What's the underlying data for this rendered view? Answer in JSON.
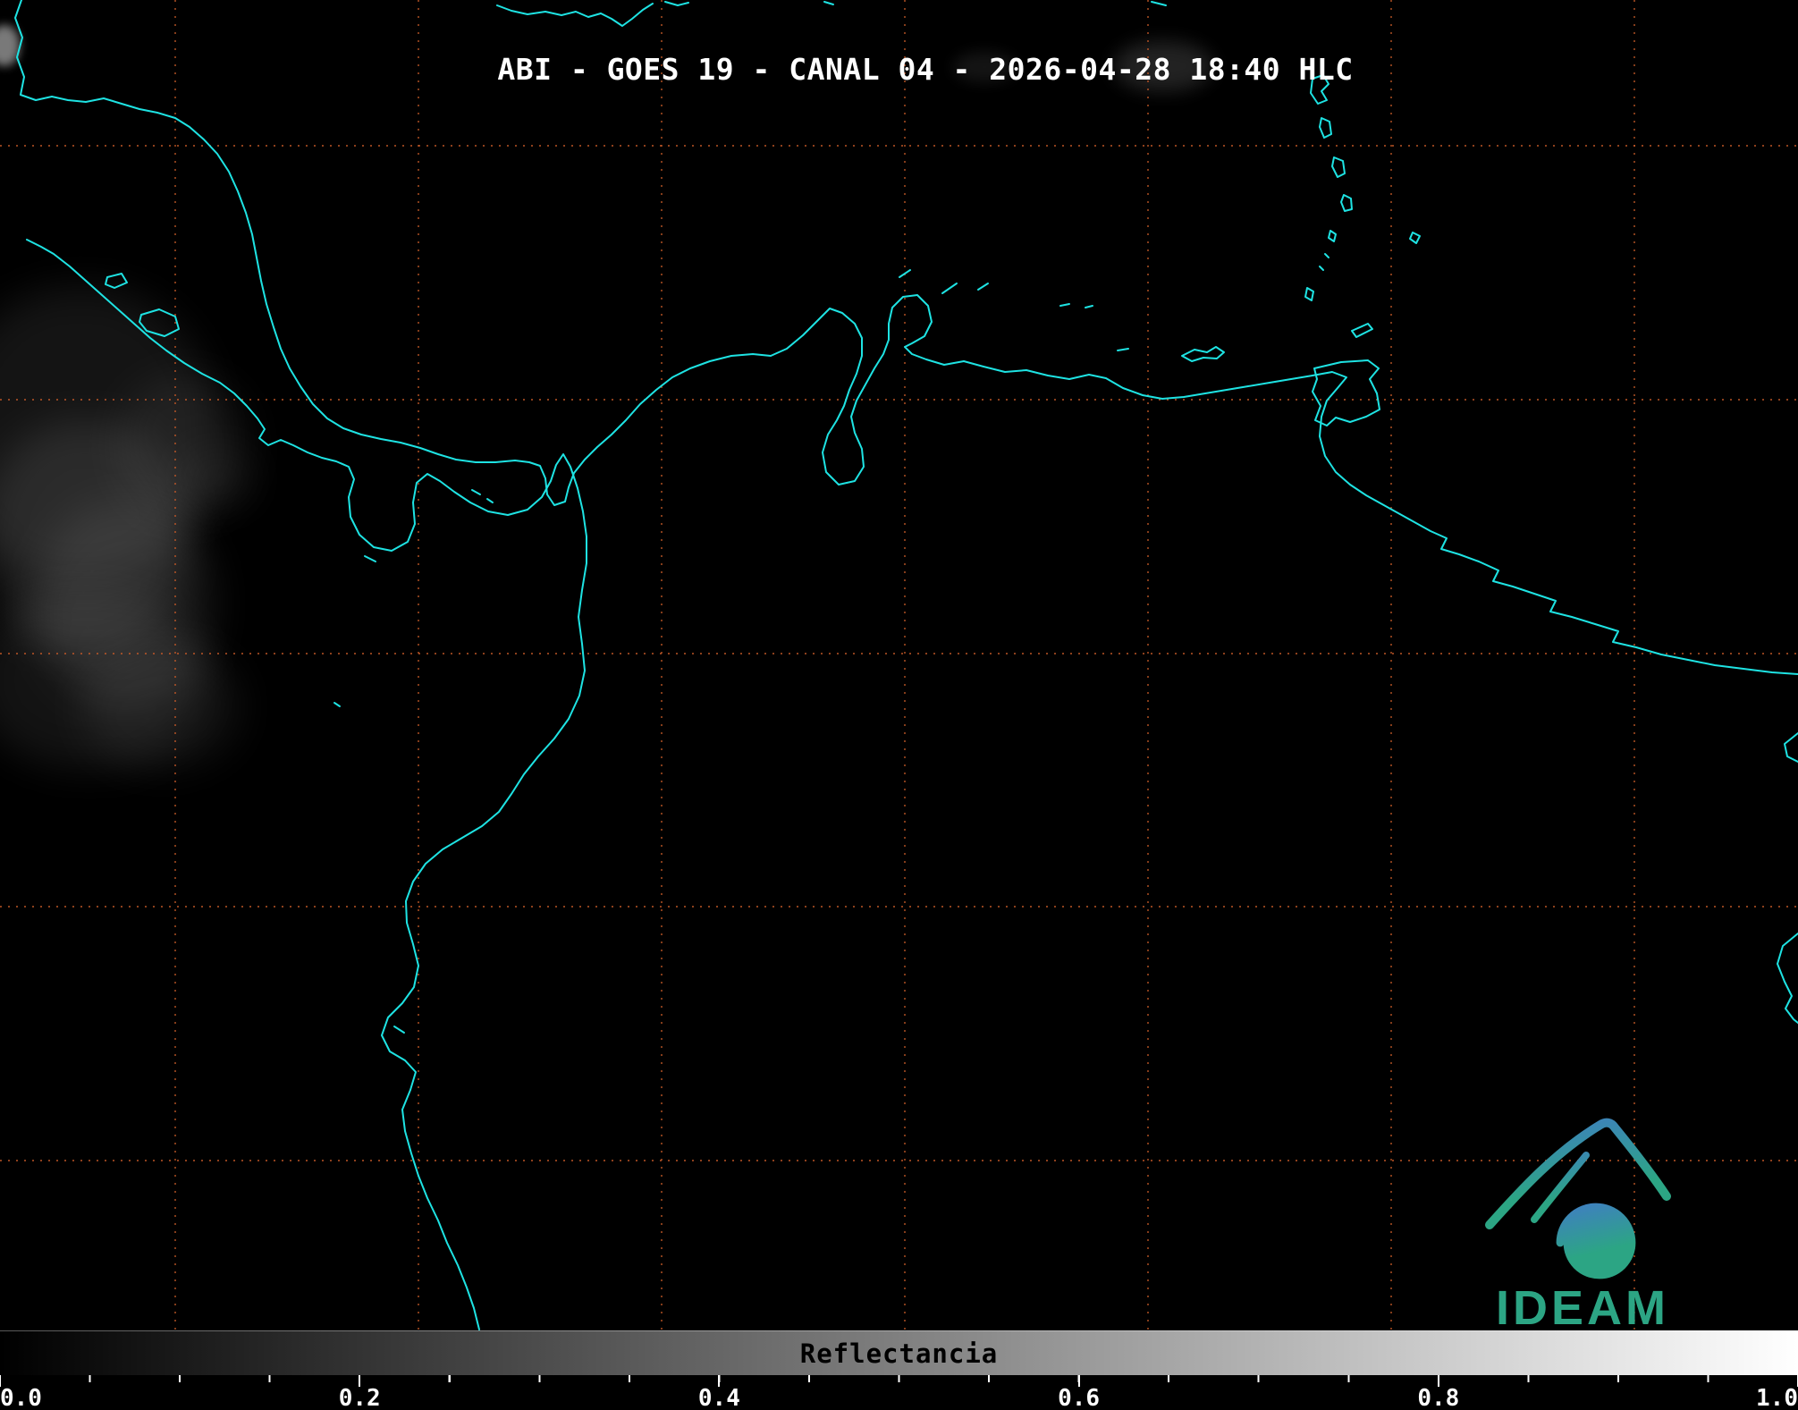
{
  "header": {
    "title": "ABI - GOES 19 - CANAL 04 - 2026-04-28 18:40 HLC"
  },
  "map": {
    "background_color": "#000000",
    "coastline_color": "#1ee3e3",
    "grid_color": "#c85a28"
  },
  "colorbar": {
    "label": "Reflectancia",
    "min": 0.0,
    "max": 1.0,
    "ticks": [
      "0.0",
      "0.2",
      "0.4",
      "0.6",
      "0.8",
      "1.0"
    ],
    "gradient_start": "#000000",
    "gradient_end": "#ffffff"
  },
  "logo": {
    "text": "IDEAM",
    "color_green": "#2ca584",
    "color_blue": "#3f7fc1"
  }
}
